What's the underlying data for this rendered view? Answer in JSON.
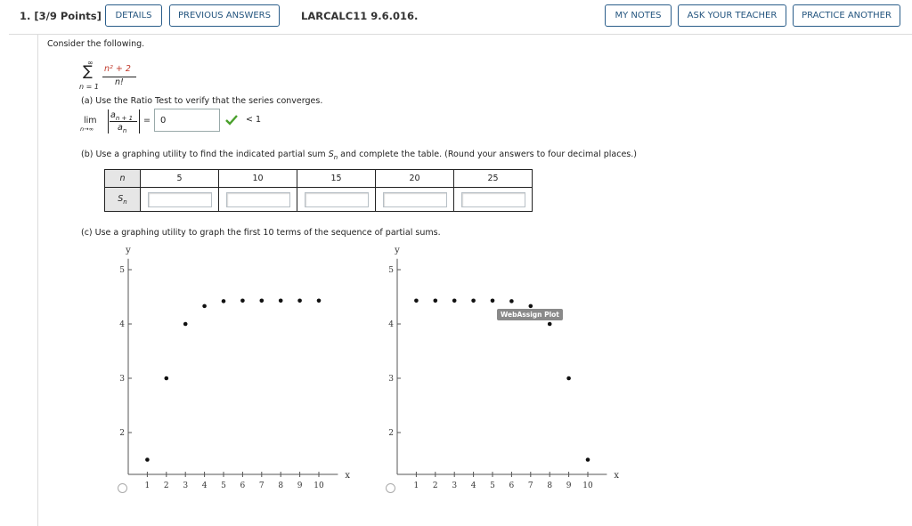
{
  "header": {
    "question_number": "1. [3/9 Points]",
    "details": "DETAILS",
    "previous_answers": "PREVIOUS ANSWERS",
    "problem_code": "LARCALC11 9.6.016.",
    "my_notes": "MY NOTES",
    "ask_teacher": "ASK YOUR TEACHER",
    "practice_another": "PRACTICE ANOTHER"
  },
  "intro": "Consider the following.",
  "series": {
    "sigma": "∑",
    "upper": "∞",
    "lower": "n = 1",
    "numerator": "n² + 2",
    "denominator": "n!"
  },
  "part_a": {
    "text": "(a) Use the Ratio Test to verify that the series converges.",
    "lim": "lim",
    "lim_sub": "n→∞",
    "ratio_num": "a",
    "ratio_num_sub": "n + 1",
    "ratio_den": "a",
    "ratio_den_sub": "n",
    "equals": "=",
    "answer": "0",
    "less_than": "< 1",
    "check_color": "#4aa02c"
  },
  "part_b": {
    "text_before": "(b) Use a graphing utility to find the indicated partial sum ",
    "s": "S",
    "s_sub": "n",
    "text_after": " and complete the table. (Round your answers to four decimal places.)",
    "row_n_label": "n",
    "row_s_label": "S",
    "row_s_sub": "n",
    "columns": [
      "5",
      "10",
      "15",
      "20",
      "25"
    ]
  },
  "part_c": {
    "text": "(c) Use a graphing utility to graph the first 10 terms of the sequence of partial sums.",
    "webassign_badge": "WebAssign Plot"
  },
  "chart_data": [
    {
      "type": "scatter",
      "xlabel": "x",
      "ylabel": "y",
      "x": [
        1,
        2,
        3,
        4,
        5,
        6,
        7,
        8,
        9,
        10
      ],
      "y": [
        1.5,
        3,
        4,
        4.33,
        4.42,
        4.43,
        4.43,
        4.43,
        4.43,
        4.43
      ],
      "xticks": [
        "1",
        "2",
        "3",
        "4",
        "5",
        "6",
        "7",
        "8",
        "9",
        "10"
      ],
      "yticks": [
        "2",
        "3",
        "4",
        "5"
      ],
      "xlim": [
        0,
        11
      ],
      "ylim": [
        1.3,
        5.2
      ]
    },
    {
      "type": "scatter",
      "xlabel": "x",
      "ylabel": "y",
      "x": [
        1,
        2,
        3,
        4,
        5,
        6,
        7,
        8,
        9,
        10
      ],
      "y": [
        4.43,
        4.43,
        4.43,
        4.43,
        4.43,
        4.42,
        4.33,
        4,
        3,
        1.5
      ],
      "xticks": [
        "1",
        "2",
        "3",
        "4",
        "5",
        "6",
        "7",
        "8",
        "9",
        "10"
      ],
      "yticks": [
        "2",
        "3",
        "4",
        "5"
      ],
      "xlim": [
        0,
        11
      ],
      "ylim": [
        1.3,
        5.2
      ]
    }
  ]
}
